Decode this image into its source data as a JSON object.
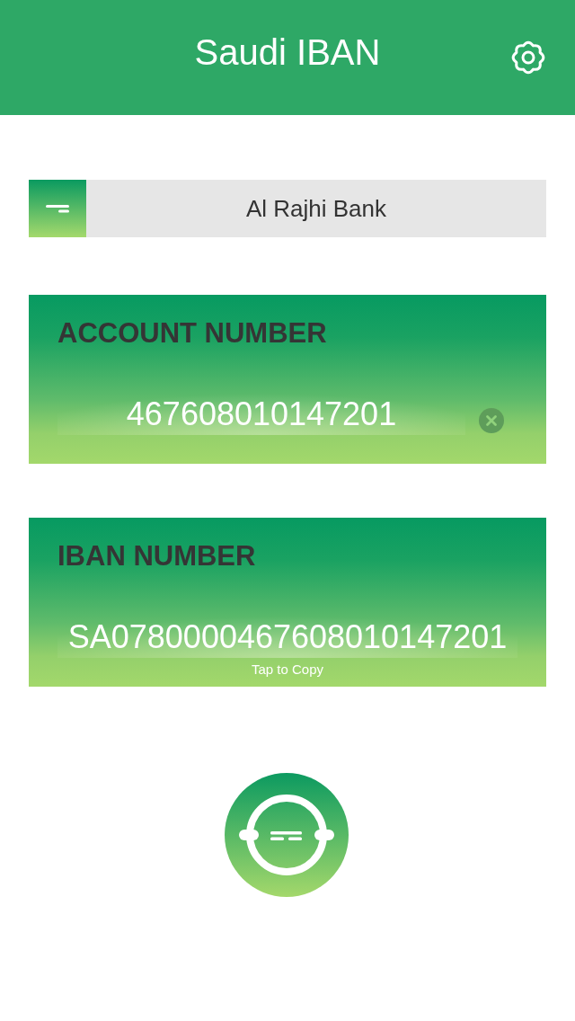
{
  "header": {
    "title": "Saudi IBAN"
  },
  "bank_selector": {
    "value": "Al Rajhi Bank"
  },
  "account": {
    "label": "ACCOUNT NUMBER",
    "value": "467608010147201"
  },
  "iban": {
    "label": "IBAN NUMBER",
    "value": "SA0780000467608010147201",
    "hint": "Tap to Copy"
  }
}
